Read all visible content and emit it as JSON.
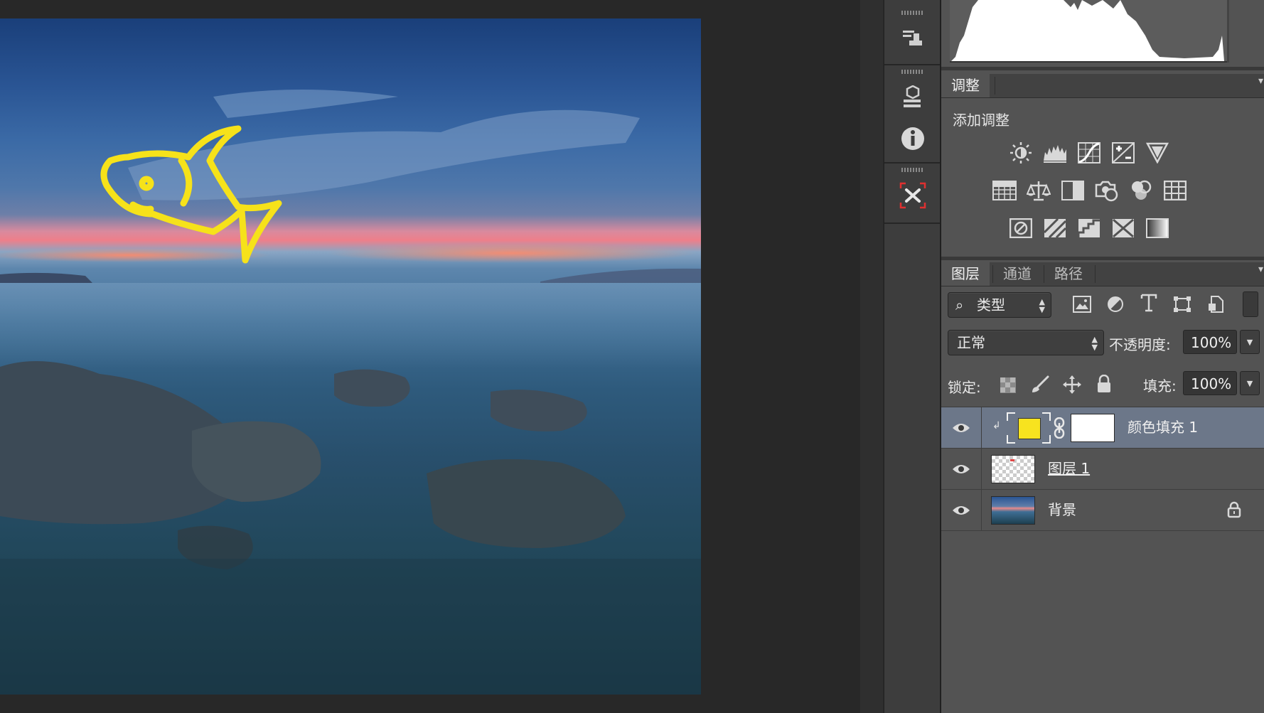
{
  "canvas": {
    "document_image": "seascape-photo-with-yellow-fish-drawing",
    "drawing_color": "#f6e21a"
  },
  "adjustments_panel": {
    "tab_label": "调整",
    "title": "添加调整",
    "icons_row1": [
      "brightness-contrast-icon",
      "levels-icon",
      "curves-icon",
      "exposure-icon",
      "vibrance-icon"
    ],
    "icons_row2": [
      "hue-saturation-icon",
      "color-balance-icon",
      "black-white-icon",
      "photo-filter-icon",
      "channel-mixer-icon",
      "color-lookup-icon"
    ],
    "icons_row3": [
      "invert-icon",
      "posterize-icon",
      "threshold-icon",
      "selective-color-icon",
      "gradient-map-icon"
    ]
  },
  "layers_panel": {
    "tabs": [
      "图层",
      "通道",
      "路径"
    ],
    "filter_kind": "类型",
    "blend_mode": "正常",
    "opacity_label": "不透明度:",
    "opacity_value": "100%",
    "lock_label": "锁定:",
    "fill_label": "填充:",
    "fill_value": "100%",
    "layers": [
      {
        "name": "颜色填充 1",
        "fill_color": "#f7e31f",
        "selected": true,
        "visible": true
      },
      {
        "name": "图层 1",
        "selected": false,
        "visible": true
      },
      {
        "name": "背景",
        "selected": false,
        "visible": true,
        "locked": true
      }
    ]
  }
}
